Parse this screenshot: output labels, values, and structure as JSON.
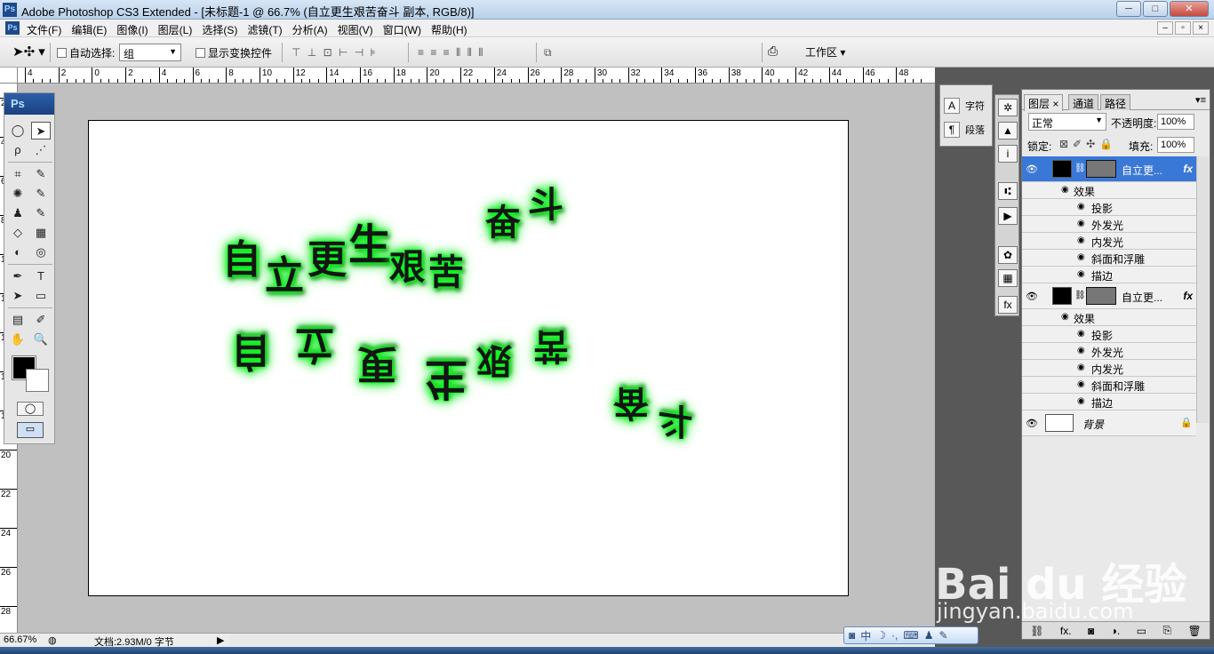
{
  "window": {
    "title": "Adobe Photoshop CS3 Extended - [未标题-1 @ 66.7% (自立更生艰苦奋斗 副本, RGB/8)]",
    "minimize": "─",
    "maximize": "□",
    "close": "✕"
  },
  "menu": {
    "items": [
      "文件(F)",
      "编辑(E)",
      "图像(I)",
      "图层(L)",
      "选择(S)",
      "滤镜(T)",
      "分析(A)",
      "视图(V)",
      "窗口(W)",
      "帮助(H)"
    ],
    "doc_controls": [
      "–",
      "▫",
      "×"
    ]
  },
  "options": {
    "auto_select_label": "自动选择:",
    "auto_select_value": "组",
    "show_transform_label": "显示变换控件",
    "workspace_label": "工作区 ▾"
  },
  "ruler": {
    "h_labels": [
      "4",
      "2",
      "0",
      "2",
      "4",
      "6",
      "8",
      "10",
      "12",
      "14",
      "16",
      "18",
      "20",
      "22",
      "24",
      "26",
      "28",
      "30",
      "32",
      "34",
      "36",
      "38",
      "40",
      "42",
      "44",
      "46",
      "48"
    ],
    "v_labels": [
      "2",
      "4",
      "6",
      "8",
      "10",
      "12",
      "14",
      "16",
      "18",
      "20",
      "22",
      "24",
      "26",
      "28"
    ]
  },
  "canvas": {
    "line1_chars": [
      "自",
      "立",
      "更",
      "生",
      "艰",
      "苦",
      "奋",
      "斗"
    ],
    "line2_chars": [
      "自",
      "立",
      "更",
      "生",
      "艰",
      "苦",
      "奋",
      "斗"
    ]
  },
  "toolbox": {
    "header": "Ps",
    "tools": [
      "◯",
      "➤",
      "ρ",
      "⋰",
      "⌗",
      "✎",
      "✺",
      "✎",
      "♟",
      "✎",
      "◇",
      "▦",
      "◐",
      "◎",
      "✒",
      "T",
      "➤",
      "▭",
      "▤",
      "✐",
      "✋",
      "🔍"
    ],
    "quick_mask": "◯",
    "screen_mode": "▭"
  },
  "status": {
    "zoom": "66.67%",
    "doc_info": "文档:2.93M/0 字节"
  },
  "side_strip": {
    "char_label": "字符",
    "para_label": "段落",
    "char_icon": "A",
    "para_icon": "¶"
  },
  "icon_column": [
    "✲",
    "▲",
    "i",
    "⑆",
    "▶",
    "✿",
    "▦",
    "fx"
  ],
  "layers_panel": {
    "tabs": [
      "图层 ×",
      "通道",
      "路径"
    ],
    "blend_mode": "正常",
    "opacity_label": "不透明度:",
    "opacity_value": "100%",
    "lock_label": "锁定:",
    "fill_label": "填充:",
    "fill_value": "100%",
    "layers": [
      {
        "name": "自立更...",
        "selected": true,
        "fx": "fx",
        "effects_label": "效果",
        "effects": [
          "投影",
          "外发光",
          "内发光",
          "斜面和浮雕",
          "描边"
        ]
      },
      {
        "name": "自立更...",
        "selected": false,
        "fx": "fx",
        "effects_label": "效果",
        "effects": [
          "投影",
          "外发光",
          "内发光",
          "斜面和浮雕",
          "描边"
        ]
      }
    ],
    "background_name": "背景",
    "bottom_icons": [
      "⛓",
      "fx.",
      "◙",
      "◑.",
      "▭",
      "⎘",
      "🗑"
    ]
  },
  "ime": {
    "items": [
      "◙",
      "中",
      "☽",
      "·,",
      "⌨",
      "♟",
      "✎"
    ]
  },
  "watermark": {
    "main": "Bai du 经验",
    "sub": "jingyan.baidu.com"
  },
  "colors": {
    "glow": "#1cff2c",
    "selection": "#3a78d7",
    "dock": "#585858"
  }
}
